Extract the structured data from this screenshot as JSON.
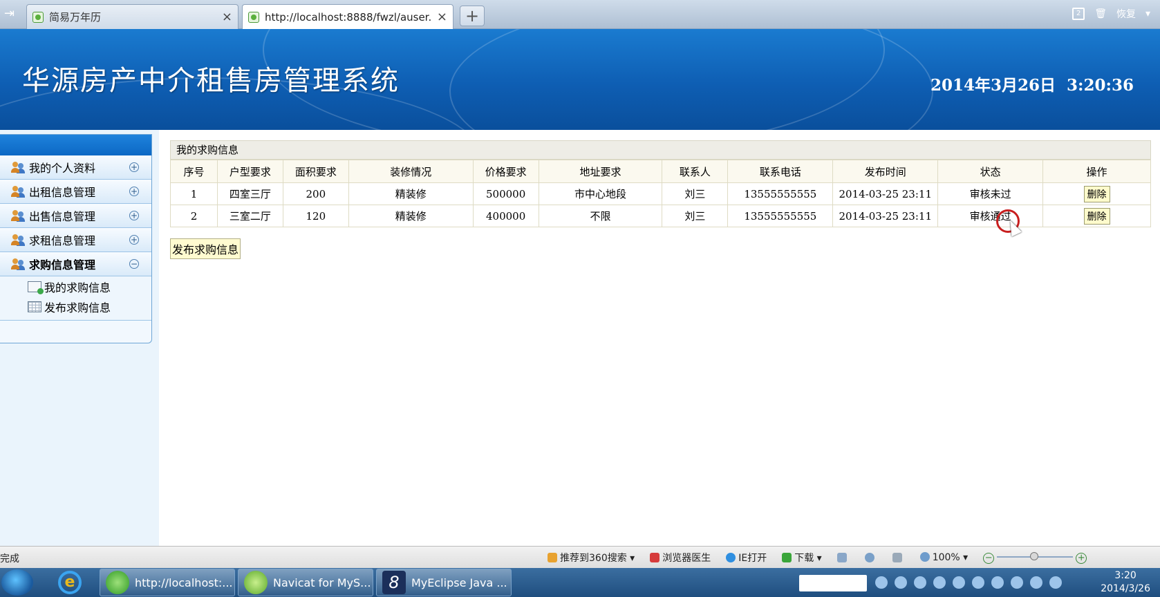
{
  "browser": {
    "tabs": [
      {
        "label": "简易万年历",
        "close": "×"
      },
      {
        "label": "http://localhost:8888/fwzl/auser...",
        "close": "×"
      }
    ],
    "new_tab": "+",
    "tab_count": "2",
    "restore": "恢复"
  },
  "header": {
    "title": "华源房产中介租售房管理系统",
    "datetime": "2014年3月26日  3:20:36"
  },
  "sidebar": {
    "items": [
      {
        "label": "我的个人资料",
        "toggle": "+"
      },
      {
        "label": "出租信息管理",
        "toggle": "+"
      },
      {
        "label": "出售信息管理",
        "toggle": "+"
      },
      {
        "label": "求租信息管理",
        "toggle": "+"
      },
      {
        "label": "求购信息管理",
        "toggle": "−"
      }
    ],
    "subitems": [
      {
        "label": "我的求购信息"
      },
      {
        "label": "发布求购信息"
      }
    ]
  },
  "main": {
    "caption": "我的求购信息",
    "columns": [
      "序号",
      "户型要求",
      "面积要求",
      "装修情况",
      "价格要求",
      "地址要求",
      "联系人",
      "联系电话",
      "发布时间",
      "状态",
      "操作"
    ],
    "rows": [
      {
        "no": "1",
        "layout": "四室三厅",
        "area": "200",
        "decoration": "精装修",
        "price": "500000",
        "address": "市中心地段",
        "contact": "刘三",
        "phone": "13555555555",
        "time": "2014-03-25 23:11",
        "status": "审核未过",
        "action": "删除"
      },
      {
        "no": "2",
        "layout": "三室二厅",
        "area": "120",
        "decoration": "精装修",
        "price": "400000",
        "address": "不限",
        "contact": "刘三",
        "phone": "13555555555",
        "time": "2014-03-25 23:11",
        "status": "审核通过",
        "action": "删除"
      }
    ],
    "publish_button": "发布求购信息"
  },
  "statusbar": {
    "status": "完成",
    "recommend": "推荐到360搜索",
    "doctor": "浏览器医生",
    "ie_open": "IE打开",
    "download": "下载",
    "zoom": "100%"
  },
  "taskbar": {
    "tasks": [
      {
        "label": "http://localhost:..."
      },
      {
        "label": "Navicat for MyS..."
      },
      {
        "label": "MyEclipse Java ..."
      }
    ],
    "clock_time": "3:20",
    "clock_date": "2014/3/26"
  }
}
